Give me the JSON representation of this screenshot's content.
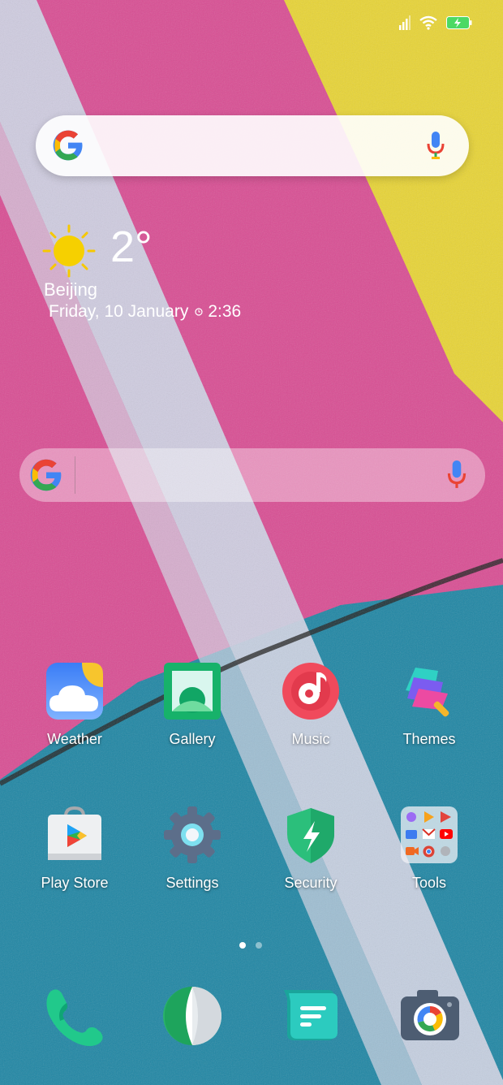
{
  "status_bar": {
    "icons": [
      "signal-icon",
      "wifi-icon",
      "battery-charging-icon"
    ]
  },
  "search_widget_top": {
    "logo": "google-icon",
    "mic": "mic-icon"
  },
  "weather": {
    "temperature": "2°",
    "city": "Beijing",
    "date": "Friday, 10 January",
    "time": "2:36",
    "condition_icon": "sun-icon"
  },
  "search_widget_mid": {
    "logo": "google-icon",
    "mic": "mic-icon"
  },
  "apps": {
    "row1": [
      {
        "label": "Weather",
        "icon": "weather-app-icon"
      },
      {
        "label": "Gallery",
        "icon": "gallery-app-icon"
      },
      {
        "label": "Music",
        "icon": "music-app-icon"
      },
      {
        "label": "Themes",
        "icon": "themes-app-icon"
      }
    ],
    "row2": [
      {
        "label": "Play Store",
        "icon": "play-store-icon"
      },
      {
        "label": "Settings",
        "icon": "settings-icon"
      },
      {
        "label": "Security",
        "icon": "security-icon"
      },
      {
        "label": "Tools",
        "icon": "tools-folder-icon"
      }
    ]
  },
  "pager": {
    "pages": 2,
    "current": 1
  },
  "dock": [
    "phone-icon",
    "browser-icon",
    "messages-icon",
    "camera-icon"
  ],
  "colors": {
    "wallpaper_pink": "#d94d93",
    "wallpaper_yellow": "#e8d435",
    "wallpaper_blue": "#1f86a4",
    "wallpaper_white": "#cfd3e4"
  }
}
